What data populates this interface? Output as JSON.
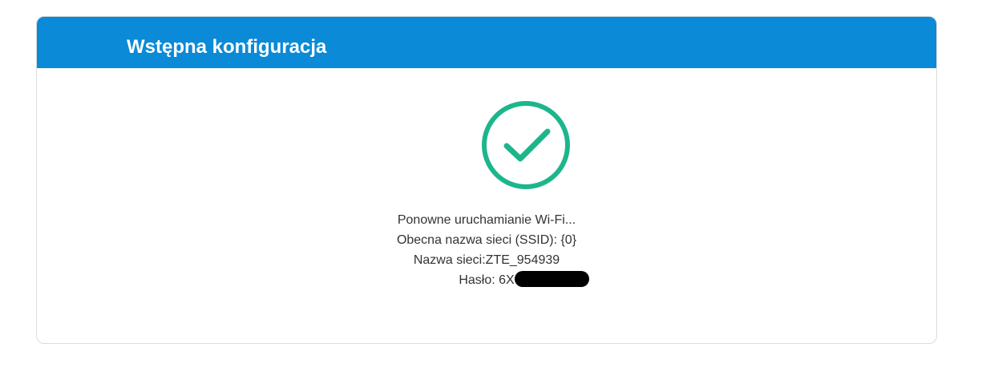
{
  "header": {
    "title": "Wstępna konfiguracja",
    "background_color": "#0a8ad7"
  },
  "status": {
    "icon": "checkmark-circle-icon",
    "icon_color": "#1db68c",
    "lines": {
      "restart": "Ponowne uruchamianie Wi-Fi...",
      "ssid": "Obecna nazwa sieci (SSID): {0}",
      "network_name": "Nazwa sieci:ZTE_954939",
      "password": "Hasło: 6X"
    },
    "password_redacted": true
  }
}
